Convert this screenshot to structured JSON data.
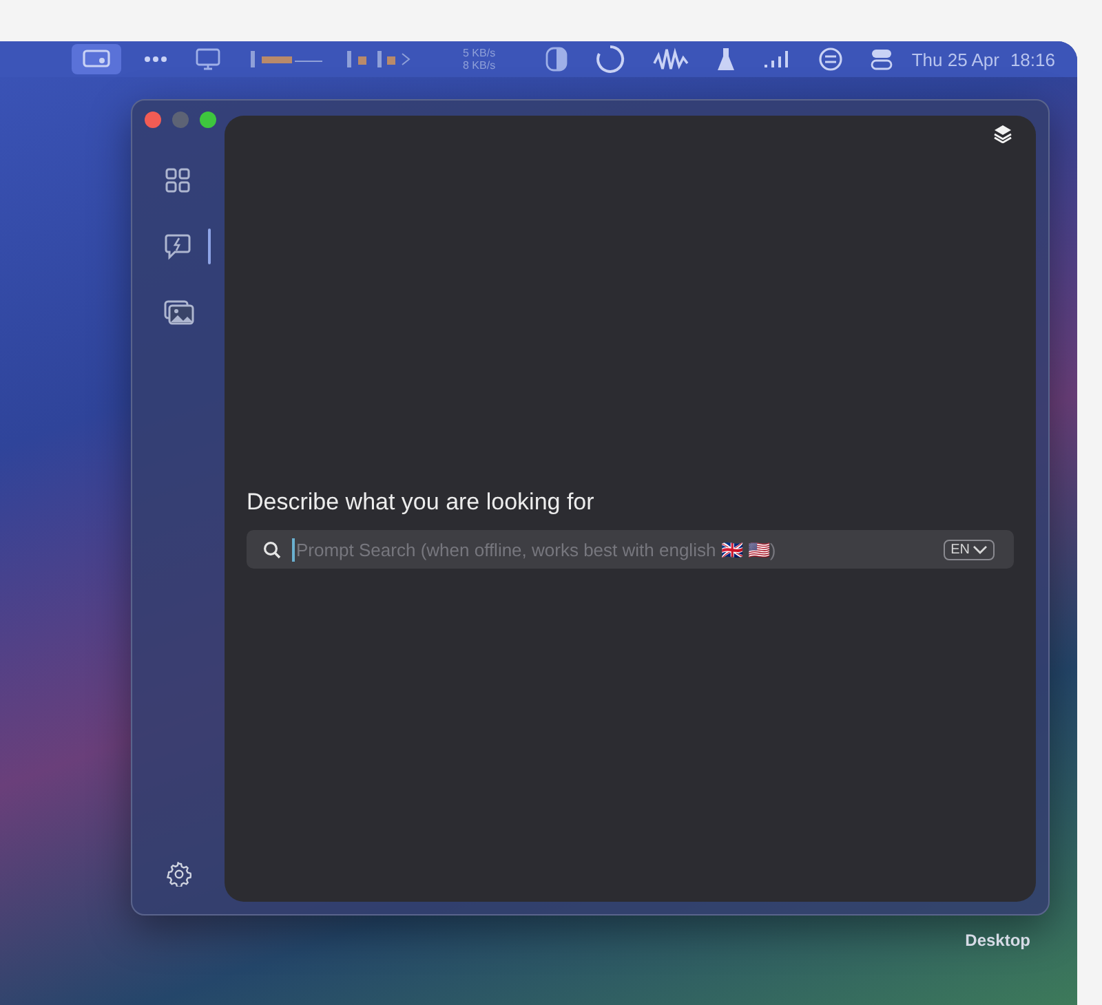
{
  "menu_bar": {
    "icons_left": [
      {
        "kind": "display",
        "selected": true
      },
      {
        "kind": "dots",
        "selected": false
      },
      {
        "kind": "monitor",
        "selected": false
      },
      {
        "kind": "meter",
        "selected": false
      }
    ],
    "network": {
      "upload": "5 KB/s",
      "download": "8 KB/s"
    },
    "icons_right": [
      {
        "kind": "contrast",
        "selected": false
      },
      {
        "kind": "ring",
        "selected": false
      },
      {
        "kind": "wave",
        "selected": false
      },
      {
        "kind": "flask",
        "selected": false
      },
      {
        "kind": "signal",
        "selected": false
      },
      {
        "kind": "swap",
        "selected": false
      },
      {
        "kind": "toggles",
        "selected": false
      }
    ],
    "date": "Thu 25 Apr",
    "time": "18:16"
  },
  "sidebar": {
    "items": [
      {
        "kind": "grid",
        "selected": false
      },
      {
        "kind": "chat",
        "selected": true
      },
      {
        "kind": "gallery",
        "selected": false
      }
    ],
    "footer": {
      "kind": "settings"
    }
  },
  "search": {
    "heading": "Describe what you are looking for",
    "placeholder": "Prompt Search (when offline, works best with english 🇬🇧 🇺🇸)",
    "language": "EN"
  },
  "desktop_label": "Desktop"
}
